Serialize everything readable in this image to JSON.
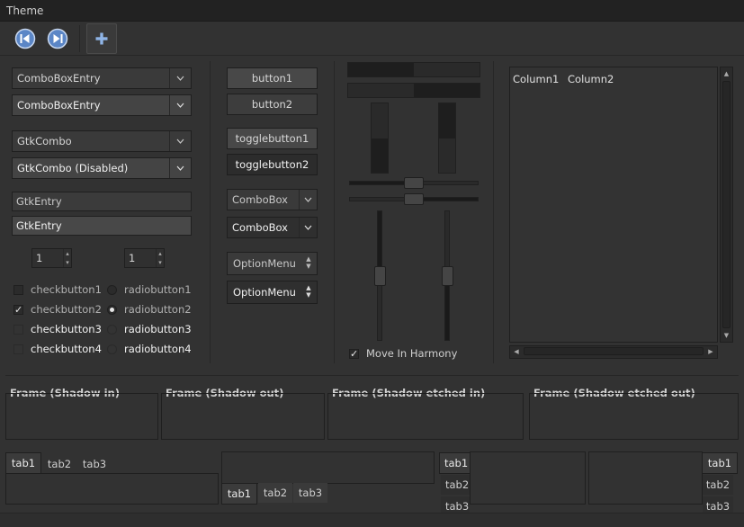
{
  "window": {
    "title": "Theme"
  },
  "toolbar": {
    "items": [
      {
        "icon": "go-first-icon"
      },
      {
        "icon": "go-last-icon"
      },
      {
        "icon": "add-icon"
      }
    ]
  },
  "col1": {
    "combo_entry": [
      "ComboBoxEntry",
      "ComboBoxEntry"
    ],
    "gtk_combo": [
      "GtkCombo",
      "GtkCombo (Disabled)"
    ],
    "entries": [
      "GtkEntry",
      "GtkEntry"
    ],
    "spin": [
      "1",
      "1"
    ],
    "checks": [
      "checkbutton1",
      "checkbutton2",
      "checkbutton3",
      "checkbutton4"
    ],
    "radios": [
      "radiobutton1",
      "radiobutton2",
      "radiobutton3",
      "radiobutton4"
    ]
  },
  "col2": {
    "buttons": [
      "button1",
      "button2"
    ],
    "toggles": [
      "togglebutton1",
      "togglebutton2"
    ],
    "comboboxes": [
      "ComboBox",
      "ComboBox"
    ],
    "optionmenus": [
      "OptionMenu",
      "OptionMenu"
    ]
  },
  "col3": {
    "harmony_label": "Move In Harmony",
    "progress": [
      0.5,
      0.5,
      0.5,
      0.5
    ],
    "scales": [
      0.5,
      0.5,
      0.5,
      0.5
    ]
  },
  "tree": {
    "columns": [
      "Column1",
      "Column2"
    ]
  },
  "frames": [
    "Frame (Shadow in)",
    "Frame (Shadow out)",
    "Frame (Shadow etched in)",
    "Frame (Shadow etched out)"
  ],
  "notebooks": [
    {
      "tabs": [
        "tab1",
        "tab2",
        "tab3"
      ],
      "position": "top"
    },
    {
      "tabs": [
        "tab1",
        "tab2",
        "tab3"
      ],
      "position": "bottom"
    },
    {
      "tabs": [
        "tab1",
        "tab2",
        "tab3"
      ],
      "position": "left"
    },
    {
      "tabs": [
        "tab1",
        "tab2",
        "tab3"
      ],
      "position": "right"
    }
  ]
}
